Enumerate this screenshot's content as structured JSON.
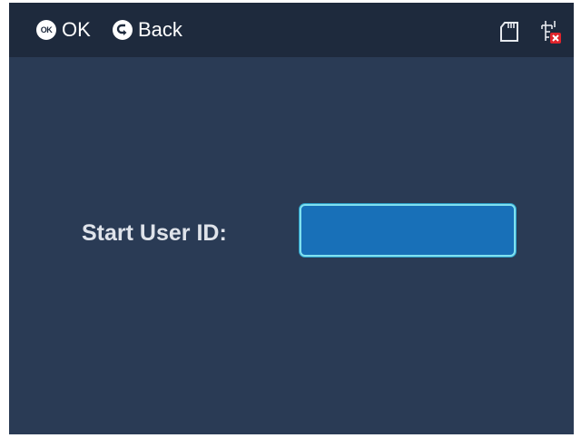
{
  "topbar": {
    "ok_icon_label": "OK",
    "ok_label": "OK",
    "back_label": "Back",
    "status_icons": [
      "sd-card-icon",
      "network-disconnected-icon"
    ]
  },
  "form": {
    "start_user_id_label": "Start User ID:",
    "start_user_id_value": ""
  },
  "colors": {
    "background": "#2a3b55",
    "topbar": "#1e2a3d",
    "input_fill": "#1870b8",
    "input_border": "#7fe0f0",
    "disconnected_badge": "#e0242c"
  }
}
